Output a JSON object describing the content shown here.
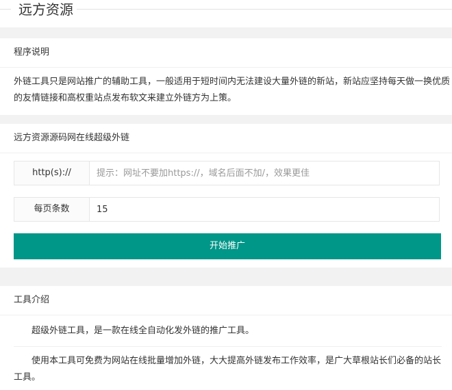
{
  "site": {
    "title": "远方资源"
  },
  "program_info": {
    "header": "程序说明",
    "text": "外链工具只是网站推广的辅助工具，一般适用于短时间内无法建设大量外链的新站，新站应坚持每天做一换优质的友情链接和高权重站点发布软文来建立外链方为上策。"
  },
  "tool_form": {
    "header": "远方资源源码网在线超级外链",
    "url_label": "http(s)://",
    "url_placeholder": "提示：网址不要加https://，域名后面不加/，效果更佳",
    "url_value": "",
    "per_page_label": "每页条数",
    "per_page_value": "15",
    "submit_label": "开始推广"
  },
  "intro": {
    "header": "工具介绍",
    "paragraphs": [
      "超级外链工具，是一款在线全自动化发外链的推广工具。",
      "使用本工具可免费为网站在线批量增加外链，大大提高外链发布工作效率，是广大草根站长们必备的站长工具。"
    ]
  }
}
